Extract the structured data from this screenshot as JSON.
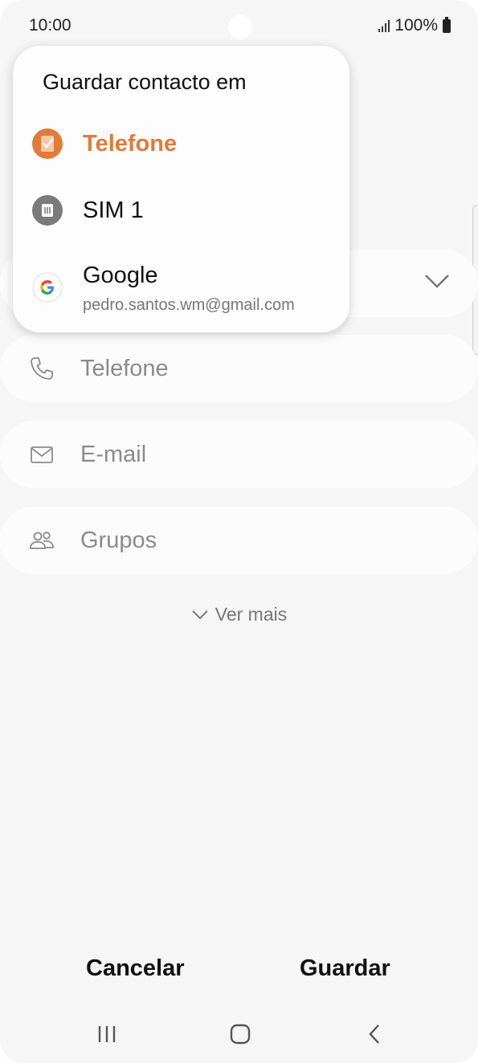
{
  "status_bar": {
    "time": "10:00",
    "battery": "100%"
  },
  "popup": {
    "title": "Guardar contacto em",
    "options": [
      {
        "label": "Telefone",
        "selected": true,
        "icon": "phone-storage-icon",
        "color": "#e07b39"
      },
      {
        "label": "SIM 1",
        "selected": false,
        "icon": "sim-card-icon"
      },
      {
        "label": "Google",
        "sub": "pedro.santos.wm@gmail.com",
        "selected": false,
        "icon": "google-icon"
      }
    ]
  },
  "form": {
    "phone_placeholder": "Telefone",
    "email_placeholder": "E-mail",
    "groups_placeholder": "Grupos",
    "more_label": "Ver mais"
  },
  "actions": {
    "cancel": "Cancelar",
    "save": "Guardar"
  },
  "colors": {
    "accent": "#e07b39",
    "background": "#f6f6f6"
  }
}
